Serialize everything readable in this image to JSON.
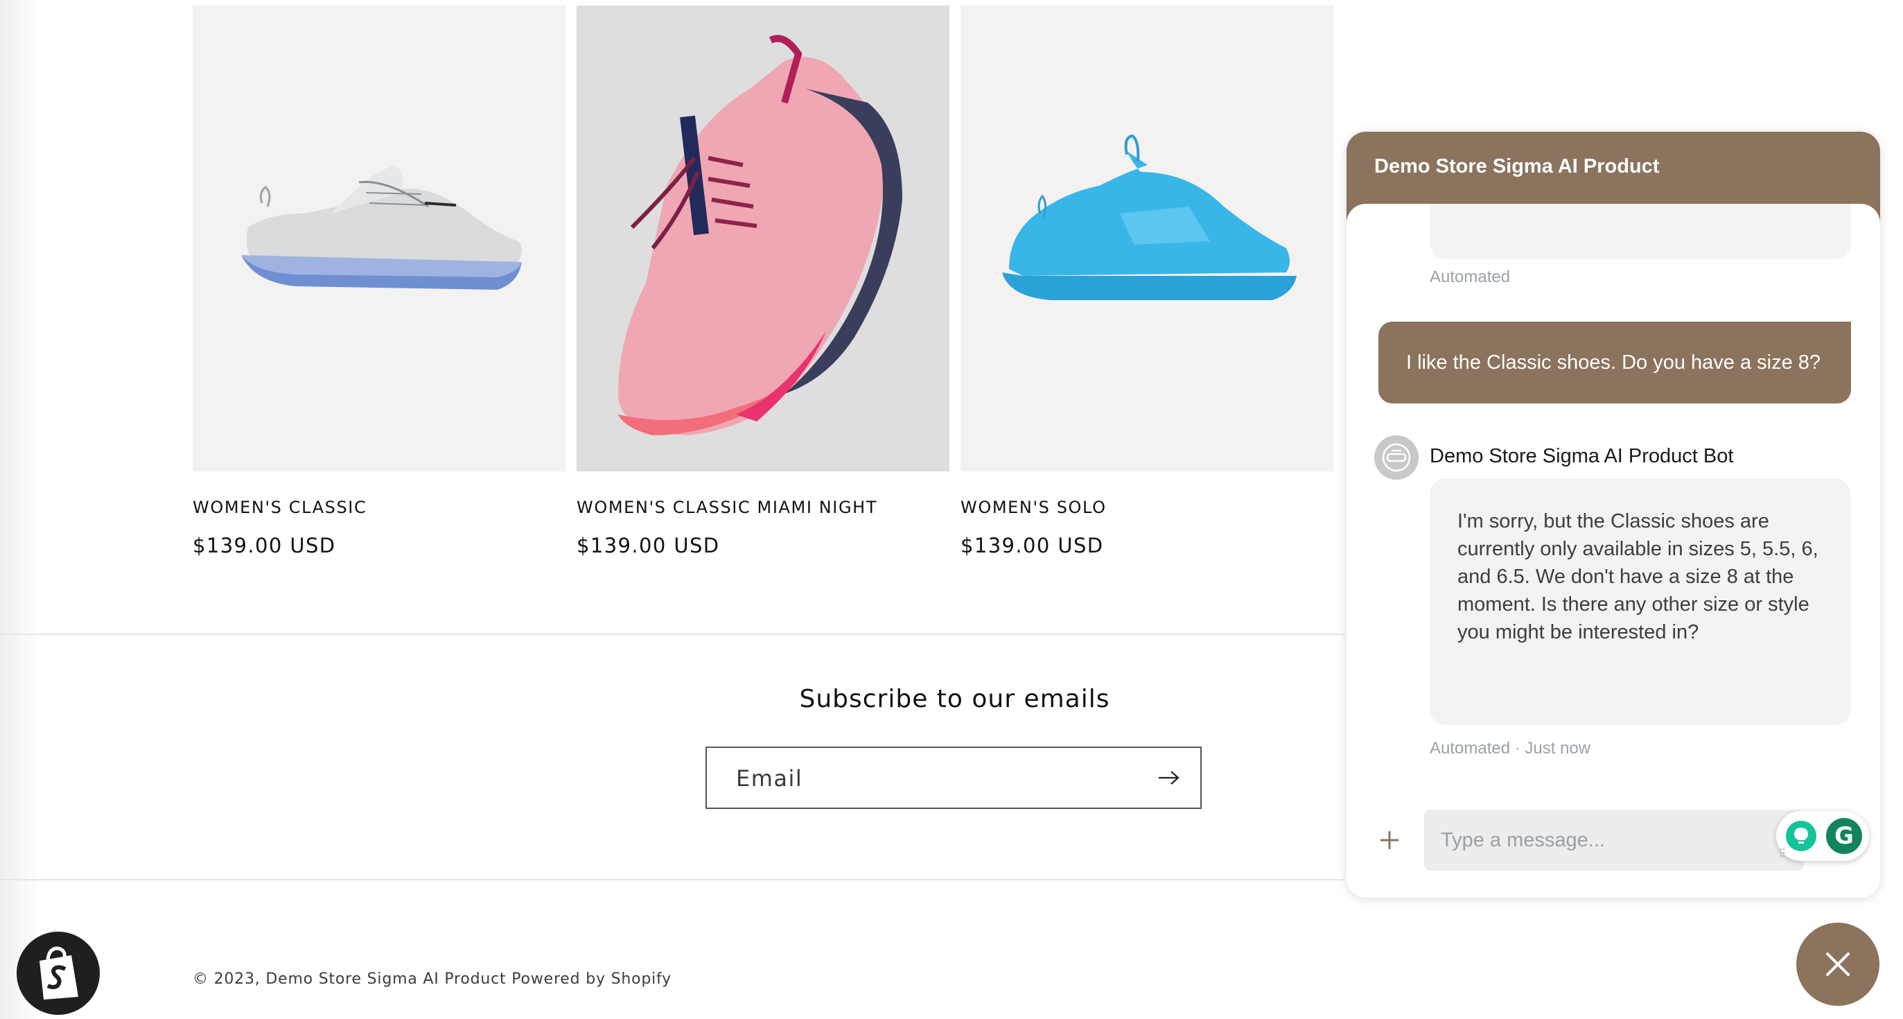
{
  "products": [
    {
      "title": "WOMEN'S CLASSIC",
      "price": "$139.00 USD"
    },
    {
      "title": "WOMEN'S CLASSIC MIAMI NIGHT",
      "price": "$139.00 USD"
    },
    {
      "title": "WOMEN'S SOLO",
      "price": "$139.00 USD"
    }
  ],
  "newsletter": {
    "heading": "Subscribe to our emails",
    "email_placeholder": "Email",
    "submit_icon": "arrow-right-icon"
  },
  "footer": {
    "copyright": "© 2023, Demo Store Sigma AI Product Powered by Shopify"
  },
  "shopify_badge": {
    "icon": "shopify-bag-icon"
  },
  "chat": {
    "header_title": "Demo Store Sigma AI Product",
    "first_meta": "Automated",
    "user_message": "I like the Classic shoes. Do you have a size 8?",
    "bot_name": "Demo Store Sigma AI Product Bot",
    "bot_message": "I'm sorry, but the Classic shoes are currently only available in sizes 5, 5.5, 6, and 6.5. We don't have a size 8 at the moment. Is there any other size or style you might be interested in?",
    "bot_meta": "Automated · Just now",
    "input_placeholder": "Type a message...",
    "attach_icon": "plus-icon",
    "close_icon": "close-icon"
  },
  "grammarly": {
    "letter": "G"
  },
  "colors": {
    "brand": "#8b735d",
    "bubble": "#f2f3f4",
    "meta_text": "#9ba1a8",
    "grammarly_green": "#15c39a"
  }
}
